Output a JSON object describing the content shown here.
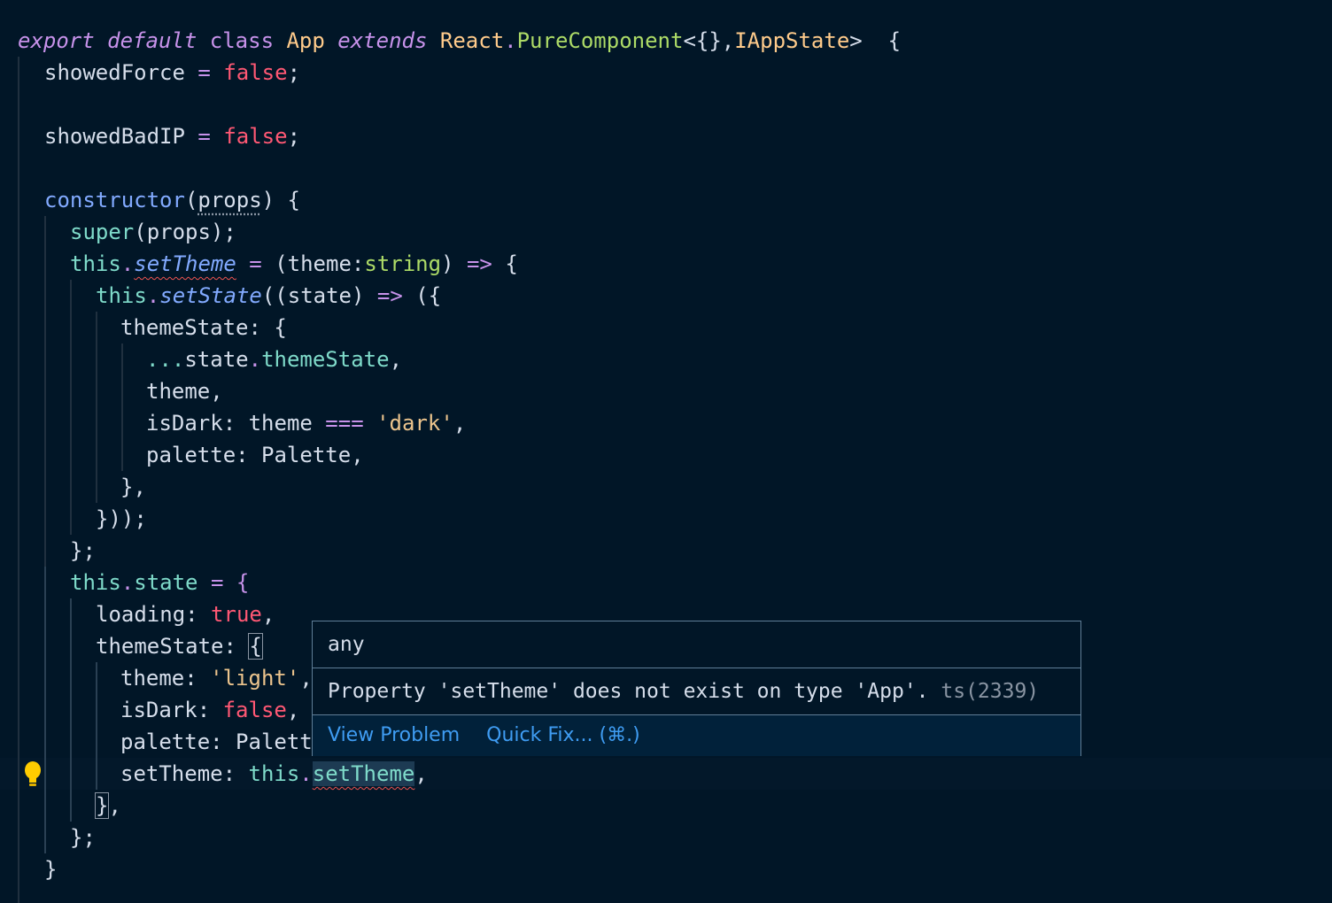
{
  "code": {
    "l1": {
      "export": "export",
      "default": "default",
      "class": "class",
      "name": "App",
      "extends": "extends",
      "react": "React",
      "dot": ".",
      "base": "PureComponent",
      "generic_open": "<{},",
      "state_type": "IAppState",
      "generic_close": ">  {"
    },
    "l2": {
      "name": "showedForce",
      "eq": " = ",
      "val": "false",
      "semi": ";"
    },
    "l4": {
      "name": "showedBadIP",
      "eq": " = ",
      "val": "false",
      "semi": ";"
    },
    "l6": {
      "fn": "constructor",
      "open": "(",
      "param": "props",
      "close": ") {"
    },
    "l7": {
      "fn": "super",
      "rest": "(props);"
    },
    "l8": {
      "this": "this",
      "dot": ".",
      "method": "setTheme",
      "eq": " = ",
      "open": "(theme:",
      "type": "string",
      "close": ") ",
      "arrow": "=>",
      "brace": " {"
    },
    "l9": {
      "this": "this",
      "dot": ".",
      "method": "setState",
      "open": "((state) ",
      "arrow": "=>",
      "rest": " ({"
    },
    "l10": {
      "text": "themeState: {"
    },
    "l11": {
      "spread": "...",
      "obj": "state",
      "dot": ".",
      "prop": "themeState",
      "comma": ","
    },
    "l12": {
      "text": "theme,"
    },
    "l13": {
      "key": "isDark: theme ",
      "op": "===",
      "sp": " ",
      "str": "'dark'",
      "comma": ","
    },
    "l14": {
      "text": "palette: Palette,"
    },
    "l15": {
      "text": "},"
    },
    "l16": {
      "text": "}));"
    },
    "l17": {
      "text": "};"
    },
    "l18": {
      "this": "this",
      "dot": ".",
      "prop": "state",
      "eq": " = {"
    },
    "l19": {
      "key": "loading: ",
      "val": "true",
      "comma": ","
    },
    "l20": {
      "key": "themeState: ",
      "brace": "{"
    },
    "l21": {
      "key": "theme: ",
      "str": "'light'",
      "comma": ","
    },
    "l22": {
      "key": "isDark: ",
      "val": "false",
      "comma": ","
    },
    "l23": {
      "text": "palette: Palett"
    },
    "l24": {
      "key": "setTheme: ",
      "this": "this",
      "dot": ".",
      "prop": "setTheme",
      "comma": ","
    },
    "l25": {
      "brace": "}",
      "comma": ","
    },
    "l26": {
      "text": "};"
    },
    "l27": {
      "text": "}"
    }
  },
  "hover": {
    "signature": "any",
    "message": "Property 'setTheme' does not exist on type 'App'.",
    "code": "ts(2339)",
    "view_problem": "View Problem",
    "quick_fix": "Quick Fix... (⌘.)"
  },
  "icons": {
    "gutter": "lightbulb-icon"
  },
  "colors": {
    "background": "#011627",
    "link": "#3f9cf2",
    "error": "#ef5350",
    "bulb": "#ffcc00"
  }
}
